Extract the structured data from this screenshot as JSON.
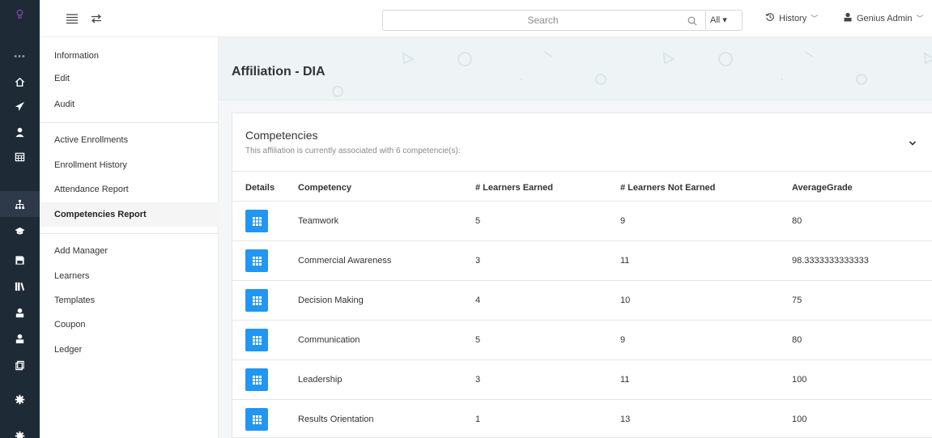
{
  "topbar": {
    "search_placeholder": "Search",
    "search_scope": "All ▾",
    "history_label": "History",
    "user_label": "Genius Admin"
  },
  "rail": {
    "icons": [
      "logo-icon",
      "more-icon",
      "home-icon",
      "paper-plane-icon",
      "user-tie-icon",
      "calendar-icon",
      "sitemap-icon",
      "graduation-cap-icon",
      "save-icon",
      "library-icon",
      "user-icon",
      "user-icon",
      "copy-icon",
      "gear-icon",
      "gear-icon"
    ],
    "active_index": 6,
    "more_label": "•••"
  },
  "sidebar": {
    "items": [
      {
        "label": "Information"
      },
      {
        "label": "Edit"
      },
      {
        "label": "Audit"
      },
      {
        "label": "Active Enrollments"
      },
      {
        "label": "Enrollment History"
      },
      {
        "label": "Attendance Report"
      },
      {
        "label": "Competencies Report",
        "active": true
      },
      {
        "label": "Add Manager"
      },
      {
        "label": "Learners"
      },
      {
        "label": "Templates"
      },
      {
        "label": "Coupon"
      },
      {
        "label": "Ledger"
      }
    ]
  },
  "page": {
    "title": "Affiliation - DIA"
  },
  "card": {
    "title": "Competencies",
    "subtitle": "This affiliation is currently associated with 6 competencie(s):"
  },
  "table": {
    "headers": [
      "Details",
      "Competency",
      "# Learners Earned",
      "# Learners Not Earned",
      "AverageGrade"
    ],
    "rows": [
      {
        "competency": "Teamwork",
        "earned": "5",
        "not_earned": "9",
        "average": "80"
      },
      {
        "competency": "Commercial Awareness",
        "earned": "3",
        "not_earned": "11",
        "average": "98.3333333333333"
      },
      {
        "competency": "Decision Making",
        "earned": "4",
        "not_earned": "10",
        "average": "75"
      },
      {
        "competency": "Communication",
        "earned": "5",
        "not_earned": "9",
        "average": "80"
      },
      {
        "competency": "Leadership",
        "earned": "3",
        "not_earned": "11",
        "average": "100"
      },
      {
        "competency": "Results Orientation",
        "earned": "1",
        "not_earned": "13",
        "average": "100"
      }
    ]
  },
  "colors": {
    "rail_bg": "#1f2a37",
    "accent_blue": "#2196f3",
    "logo_purple": "#8e44ad"
  }
}
